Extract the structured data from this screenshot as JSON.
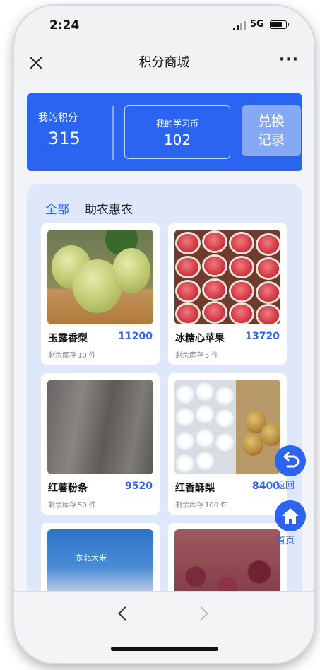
{
  "status_bar": {
    "time": "2:24",
    "network": "5G"
  },
  "navbar": {
    "title": "积分商城",
    "more": "···"
  },
  "points": {
    "my_points_label": "我的积分",
    "my_points_value": "315",
    "coin_label": "我的学习币",
    "coin_value": "102",
    "exchange_line1": "兑换",
    "exchange_line2": "记录"
  },
  "tabs": [
    {
      "label": "全部",
      "active": true
    },
    {
      "label": "助农惠农",
      "active": false
    }
  ],
  "stock_prefix": "剩余库存",
  "products": [
    {
      "name": "玉露香梨",
      "price": "11200",
      "stock": "10 件"
    },
    {
      "name": "冰糖心苹果",
      "price": "13720",
      "stock": "5 件"
    },
    {
      "name": "红薯粉条",
      "price": "9520",
      "stock": "50 件"
    },
    {
      "name": "红香酥梨",
      "price": "8400",
      "stock": "100 件"
    },
    {
      "name": "",
      "price": "",
      "stock": ""
    },
    {
      "name": "",
      "price": "",
      "stock": ""
    }
  ],
  "rice_bag_text": "东北大米",
  "floating": {
    "back_label": "返回",
    "home_label": "首页"
  },
  "colors": {
    "accent": "#2a64f0",
    "panel": "#dfe8fb"
  }
}
